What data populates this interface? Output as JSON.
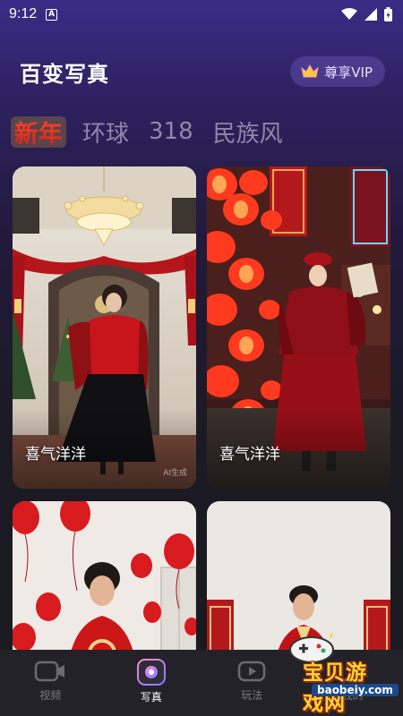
{
  "status_bar": {
    "time": "9:12",
    "notification_icon": "A"
  },
  "header": {
    "title": "百变写真",
    "vip_label": "尊享VIP"
  },
  "tabs": [
    {
      "label": "新年",
      "active": true
    },
    {
      "label": "环球",
      "active": false
    },
    {
      "label": "318",
      "active": false
    },
    {
      "label": "民族风",
      "active": false
    }
  ],
  "cards": [
    {
      "label": "喜气洋洋",
      "ai_tag": "AI生成"
    },
    {
      "label": "喜气洋洋",
      "ai_tag": ""
    },
    {
      "label": "",
      "ai_tag": ""
    },
    {
      "label": "",
      "ai_tag": ""
    }
  ],
  "bottom_nav": [
    {
      "label": "视频",
      "icon": "video-icon",
      "active": false
    },
    {
      "label": "写真",
      "icon": "camera-icon",
      "active": true
    },
    {
      "label": "玩法",
      "icon": "play-icon",
      "active": false
    },
    {
      "label": "我的",
      "icon": "profile-icon",
      "active": false
    }
  ],
  "watermark": {
    "text": "宝贝游戏网",
    "domain": "baobeiy.com"
  },
  "colors": {
    "accent_red": "#e02216",
    "vip_gold": "#ffc93a",
    "nav_bg": "#232228"
  }
}
